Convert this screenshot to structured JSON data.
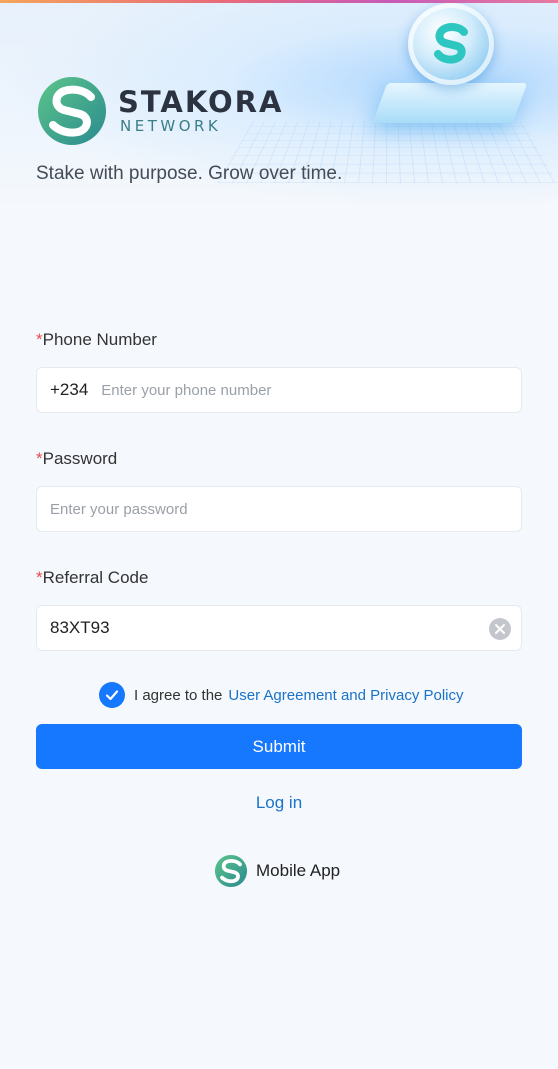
{
  "brand": {
    "name": "STAKORA",
    "subname": "NETWORK",
    "tagline": "Stake with purpose. Grow over time.",
    "colors": {
      "green": "#3aa57a",
      "teal": "#2b8a8f",
      "dark": "#2c3340"
    }
  },
  "form": {
    "phone": {
      "required_mark": "*",
      "label": "Phone Number",
      "prefix": "+234",
      "placeholder": "Enter your phone number"
    },
    "password": {
      "required_mark": "*",
      "label": "Password",
      "placeholder": "Enter your password"
    },
    "referral": {
      "required_mark": "*",
      "label": "Referral Code",
      "value": "83XT93"
    },
    "agreement": {
      "checked": true,
      "text": "I agree to the",
      "link": "User Agreement and Privacy Policy"
    },
    "submit_label": "Submit"
  },
  "links": {
    "login": "Log in",
    "mobile_app": "Mobile App"
  },
  "colors": {
    "primary": "#1677ff",
    "link": "#1a73c8",
    "required": "#e34d4d"
  },
  "icons": {
    "logo": "stakora-s-logo-icon",
    "coin": "stakora-coin-icon",
    "clear": "clear-circle-icon",
    "check": "checkmark-icon"
  }
}
